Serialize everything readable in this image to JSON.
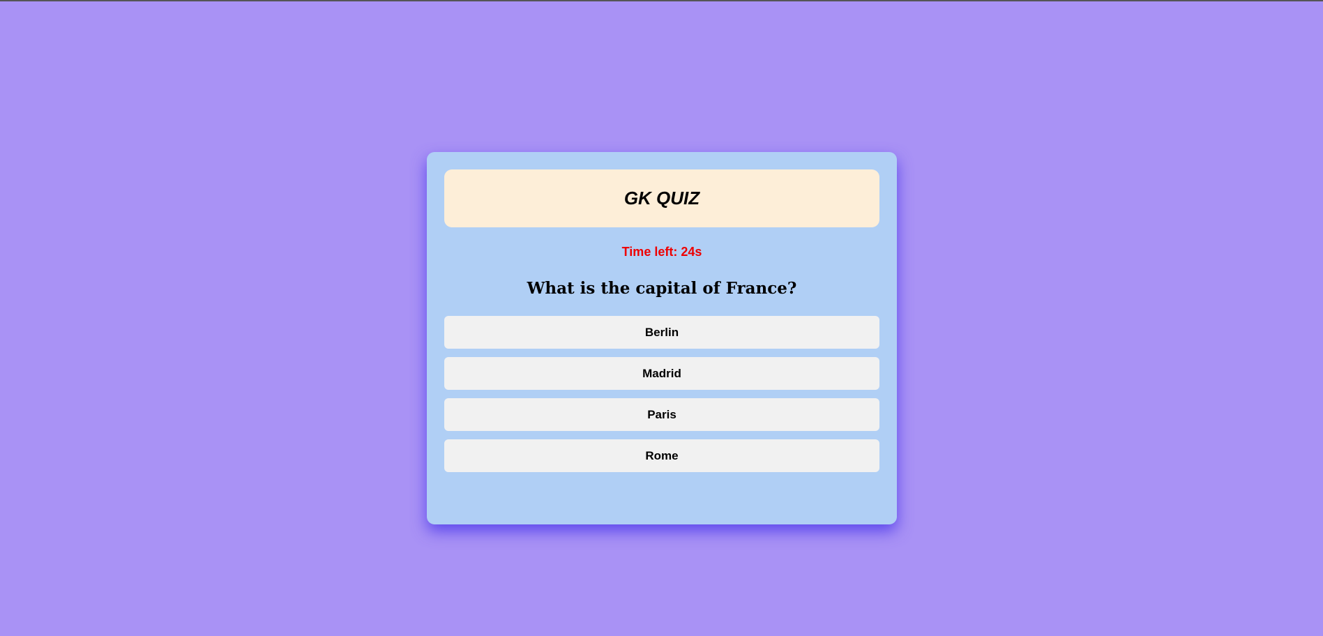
{
  "quiz": {
    "title": "GK QUIZ",
    "timer_text": "Time left: 24s",
    "question": "What is the capital of France?",
    "options": [
      "Berlin",
      "Madrid",
      "Paris",
      "Rome"
    ]
  },
  "colors": {
    "page_background": "#a992f5",
    "card_background": "#b0cff5",
    "header_background": "#fdeed8",
    "timer_text": "#ee0000",
    "option_background": "#f1f1f1"
  }
}
